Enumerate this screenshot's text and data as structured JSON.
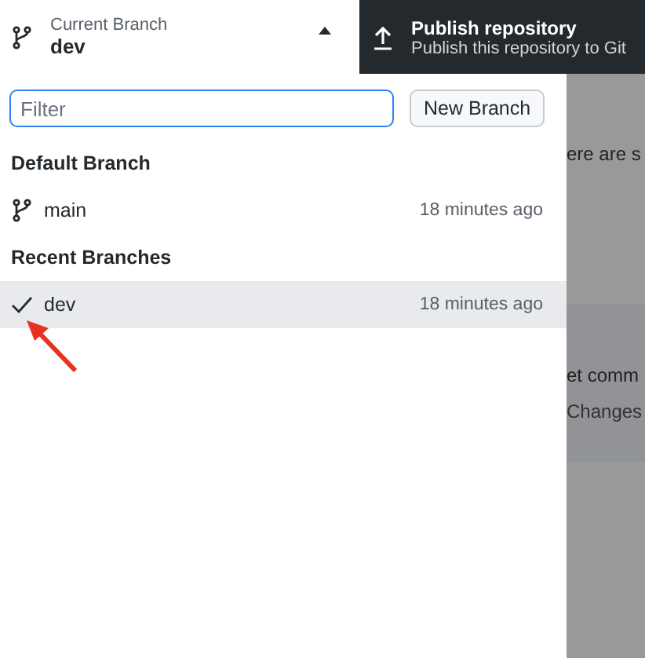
{
  "current_branch": {
    "label": "Current Branch",
    "value": "dev"
  },
  "publish": {
    "title": "Publish repository",
    "subtitle": "Publish this repository to Git"
  },
  "filter": {
    "placeholder": "Filter"
  },
  "new_branch_button": "New Branch",
  "sections": [
    {
      "title": "Default Branch",
      "branches": [
        {
          "name": "main",
          "time": "18 minutes ago",
          "selected": false
        }
      ]
    },
    {
      "title": "Recent Branches",
      "branches": [
        {
          "name": "dev",
          "time": "18 minutes ago",
          "selected": true
        }
      ]
    }
  ],
  "background_texts": [
    "ere are s",
    "et comm",
    "Changes"
  ]
}
